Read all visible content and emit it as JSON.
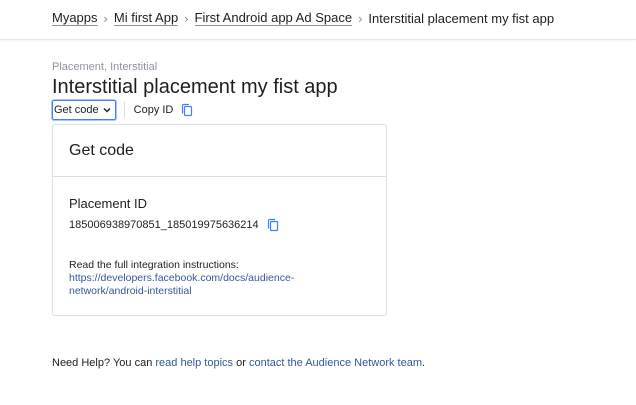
{
  "breadcrumb": {
    "items": [
      {
        "label": "Myapps"
      },
      {
        "label": "Mi first App"
      },
      {
        "label": "First Android app Ad Space"
      }
    ],
    "current": "Interstitial placement my fist app"
  },
  "placement": {
    "subtype": "Placement, Interstitial",
    "title": "Interstitial placement my fist app"
  },
  "tabs": {
    "get_code": "Get code",
    "copy_id": "Copy ID"
  },
  "card": {
    "title": "Get code",
    "placement_id_label": "Placement ID",
    "placement_id_value": "185006938970851_185019975636214",
    "instructions_text": "Read the full integration instructions:",
    "instructions_link_line1": "https://developers.facebook.com/docs/audience-",
    "instructions_link_line2": "network/android-interstitial"
  },
  "help": {
    "prefix": "Need Help? You can ",
    "link1": "read help topics",
    "middle": " or ",
    "link2": "contact the Audience Network team",
    "suffix": "."
  },
  "colors": {
    "link": "#365899",
    "accent": "#4080ff",
    "muted": "#8d949e",
    "border": "#dddfe2"
  },
  "icons": [
    "chevron-right-icon",
    "chevron-down-icon",
    "copy-icon"
  ]
}
